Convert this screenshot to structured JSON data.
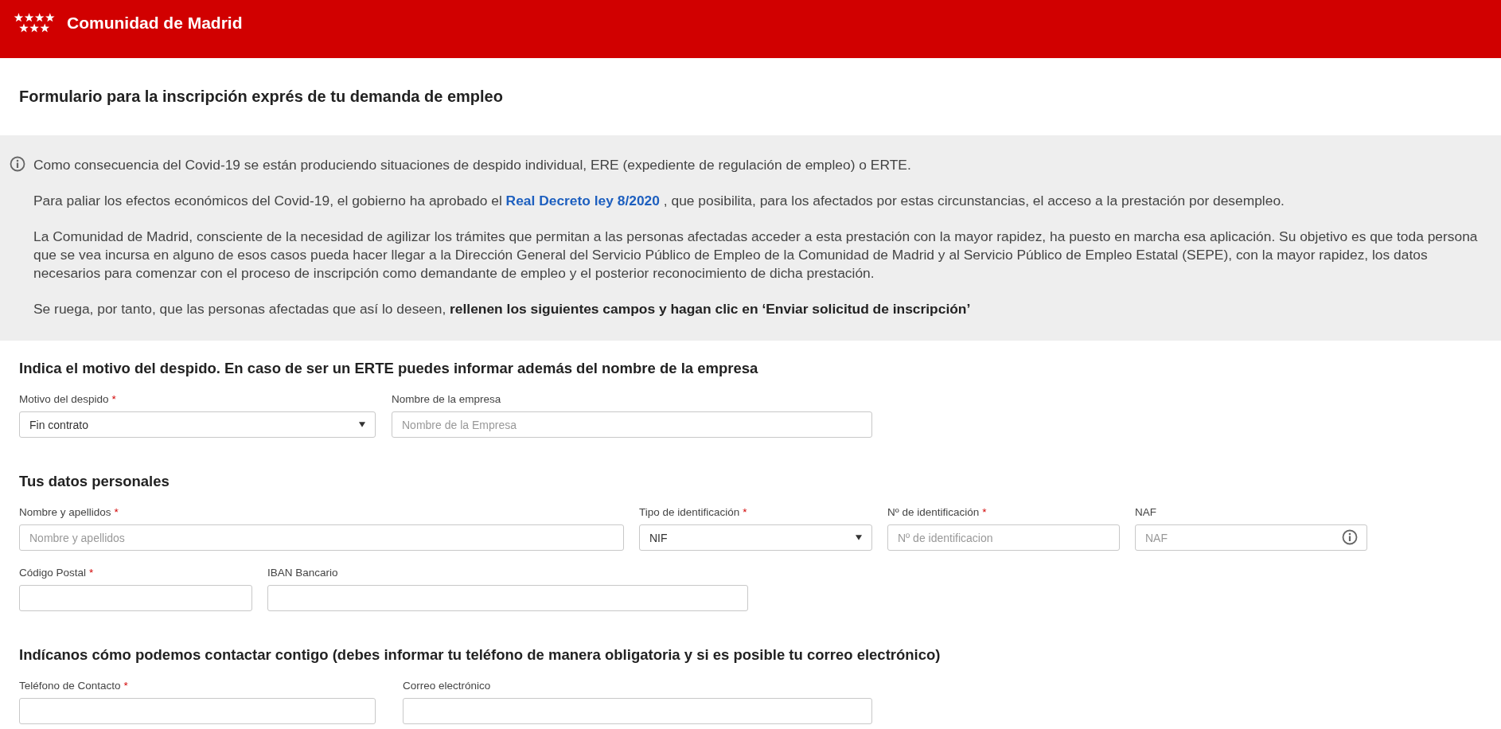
{
  "header": {
    "title": "Comunidad de Madrid"
  },
  "page_title": "Formulario para la inscripción exprés de tu demanda de empleo",
  "notice": {
    "paragraphs": [
      {
        "segments": [
          {
            "kind": "text",
            "text": "Como consecuencia del Covid-19 se están produciendo situaciones de despido individual, ERE (expediente de regulación de empleo) o ERTE."
          }
        ]
      },
      {
        "segments": [
          {
            "kind": "text",
            "text": "Para paliar los efectos económicos del Covid-19, el gobierno ha aprobado el"
          },
          {
            "kind": "link",
            "text": "Real Decreto ley 8/2020"
          },
          {
            "kind": "text",
            "text": ", que posibilita, para los afectados por estas circunstancias, el acceso a la prestación por desempleo."
          }
        ]
      },
      {
        "segments": [
          {
            "kind": "text",
            "text": "La Comunidad de Madrid, consciente de la necesidad de agilizar los trámites que permitan a las personas afectadas acceder a esta prestación con la mayor rapidez, ha puesto en marcha esa aplicación. Su objetivo es que toda persona que se vea incursa en alguno de esos casos pueda hacer llegar a la Dirección General del Servicio Público de Empleo de la Comunidad de Madrid y al Servicio Público de Empleo Estatal (SEPE), con la mayor rapidez, los datos necesarios para comenzar con el proceso de inscripción como demandante de empleo y el posterior reconocimiento de dicha prestación."
          }
        ]
      },
      {
        "segments": [
          {
            "kind": "text",
            "text": "Se ruega, por tanto, que las personas afectadas que así lo deseen, **rellenen los siguientes campos y hagan clic en ‘Enviar solicitud de inscripción’**"
          }
        ]
      }
    ]
  },
  "sections": [
    {
      "heading": "Indica el motivo del despido. En caso de ser un ERTE puedes informar además del nombre de la empresa",
      "rows": [
        [
          {
            "kind": "select",
            "label": "Motivo del despido",
            "required_mark": "*",
            "value": "Fin contrato"
          },
          {
            "kind": "input",
            "label": "Nombre de la empresa",
            "placeholder": "Nombre de la Empresa"
          }
        ]
      ]
    },
    {
      "heading": "Tus datos personales",
      "rows": [
        [
          {
            "kind": "input",
            "label": "Nombre y apellidos",
            "required_mark": "*",
            "placeholder": "Nombre y apellidos"
          },
          {
            "kind": "select",
            "label": "Tipo de identificación",
            "required_mark": "*",
            "value": "NIF"
          },
          {
            "kind": "input",
            "label": "Nº de identificación",
            "required_mark": "*",
            "placeholder": "Nº de identificacion"
          },
          {
            "kind": "input",
            "label": "NAF",
            "placeholder": "NAF",
            "info": true
          }
        ],
        [
          {
            "kind": "input",
            "label": "Código Postal",
            "required_mark": "*"
          },
          {
            "kind": "input",
            "label": "IBAN Bancario"
          }
        ]
      ]
    },
    {
      "heading": "Indícanos cómo podemos contactar contigo (debes informar tu teléfono de manera obligatoria y si es posible tu correo electrónico)",
      "rows": [
        [
          {
            "kind": "input",
            "label": "Teléfono de Contacto",
            "required_mark": "*"
          },
          {
            "kind": "input",
            "label": "Correo electrónico"
          }
        ]
      ]
    }
  ]
}
